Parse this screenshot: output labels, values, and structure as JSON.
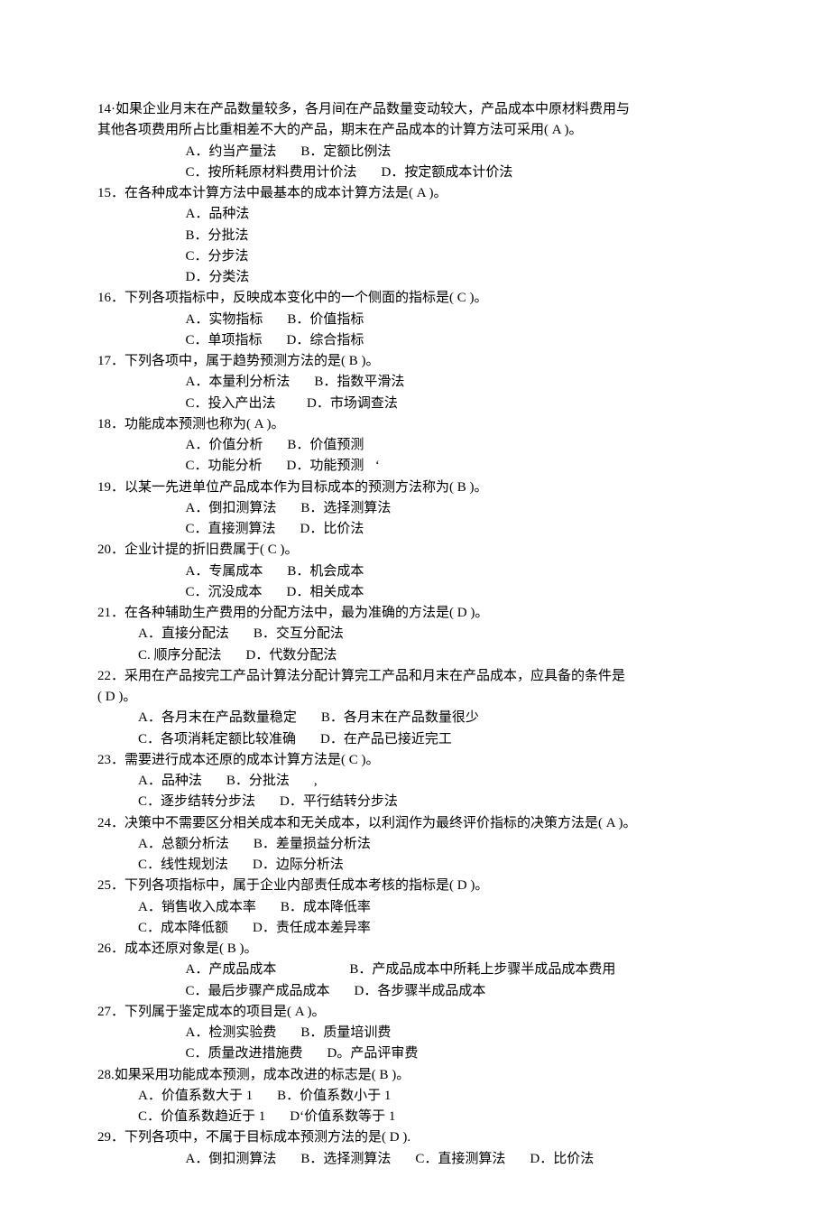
{
  "q14": {
    "stem1": "14·如果企业月末在产品数量较多，各月间在产品数量变动较大，产品成本中原材料费用与",
    "stem2": "其他各项费用所占比重相差不大的产品，期末在产品成本的计算方法可采用( A )。",
    "a": "A．约当产量法",
    "b": "B．定额比例法",
    "c": "C．按所耗原材料费用计价法",
    "d": "D．按定额成本计价法"
  },
  "q15": {
    "stem": "15．在各种成本计算方法中最基本的成本计算方法是( A )。",
    "a": "A．品种法",
    "b": "B．分批法",
    "c": "C．分步法",
    "d": "D．分类法"
  },
  "q16": {
    "stem": "16．下列各项指标中，反映成本变化中的一个侧面的指标是( C )。",
    "a": "A．实物指标",
    "b": "B．价值指标",
    "c": "C．单项指标",
    "d": "D．综合指标"
  },
  "q17": {
    "stem": "17．下列各项中，属于趋势预测方法的是( B )。",
    "a": "A．本量利分析法",
    "b": "B．指数平滑法",
    "c": "C．投入产出法",
    "d": "D．市场调查法"
  },
  "q18": {
    "stem": "18．功能成本预测也称为( A )。",
    "a": "A．价值分析",
    "b": "B．价值预测",
    "c": "C．功能分析",
    "d": "D．功能预测",
    "tail": "‘"
  },
  "q19": {
    "stem": "19．以某一先进单位产品成本作为目标成本的预测方法称为( B )。",
    "a": "A．倒扣测算法",
    "b": "B．选择测算法",
    "c": "C．直接测算法",
    "d": "D．比价法"
  },
  "q20": {
    "stem": "20．企业计提的折旧费属于( C )。",
    "a": "A．专属成本",
    "b": "B．机会成本",
    "c": "C．沉没成本",
    "d": "D．相关成本"
  },
  "q21": {
    "stem": "21．在各种辅助生产费用的分配方法中，最为准确的方法是( D )。",
    "a": "A．直接分配法",
    "b": "B．交互分配法",
    "c": "C. 顺序分配法",
    "d": "D．代数分配法"
  },
  "q22": {
    "stem1": "22．采用在产品按完工产品计算法分配计算完工产品和月末在产品成本，应具备的条件是",
    "stem2": "( D )。",
    "a": "A．各月末在产品数量稳定",
    "b": "B．各月末在产品数量很少",
    "c": "C．各项消耗定额比较准确",
    "d": "D．在产品已接近完工"
  },
  "q23": {
    "stem": "23．需要进行成本还原的成本计算方法是( C )。",
    "a": "A．品种法",
    "b": "B．分批法",
    "tail": ",",
    "c": "C．逐步结转分步法",
    "d": "D．平行结转分步法"
  },
  "q24": {
    "stem": "24．决策中不需要区分相关成本和无关成本，以利润作为最终评价指标的决策方法是( A )。",
    "a": "A．总额分析法",
    "b": "B．差量损益分析法",
    "c": "C．线性规划法",
    "d": "D．边际分析法"
  },
  "q25": {
    "stem": "25．下列各项指标中，属于企业内部责任成本考核的指标是( D )。",
    "a": "A．销售收入成本率",
    "b": "B．成本降低率",
    "c": "C．成本降低额",
    "d": "D．责任成本差异率"
  },
  "q26": {
    "stem": "26．成本还原对象是( B )。",
    "a": "A．产成品成本",
    "b": "B．产成品成本中所耗上步骤半成品成本费用",
    "c": "C．最后步骤产成品成本",
    "d": "D．各步骤半成品成本"
  },
  "q27": {
    "stem": "27．下列属于鉴定成本的项目是( A )。",
    "a": "A．检测实验费",
    "b": "B．质量培训费",
    "c": "C．质量改进措施费",
    "d": "D。产品评审费"
  },
  "q28": {
    "stem": "28.如果采用功能成本预测，成本改进的标志是( B )。",
    "a": "A．价值系数大于 1",
    "b": "B．价值系数小于 1",
    "c": "C．价值系数趋近于 1",
    "d": "D‘价值系数等于 1"
  },
  "q29": {
    "stem": "29．下列各项中，不属于目标成本预测方法的是( D ).",
    "a": "A．倒扣测算法",
    "b": "B．选择测算法",
    "c": "C．直接测算法",
    "d": "D．比价法"
  }
}
